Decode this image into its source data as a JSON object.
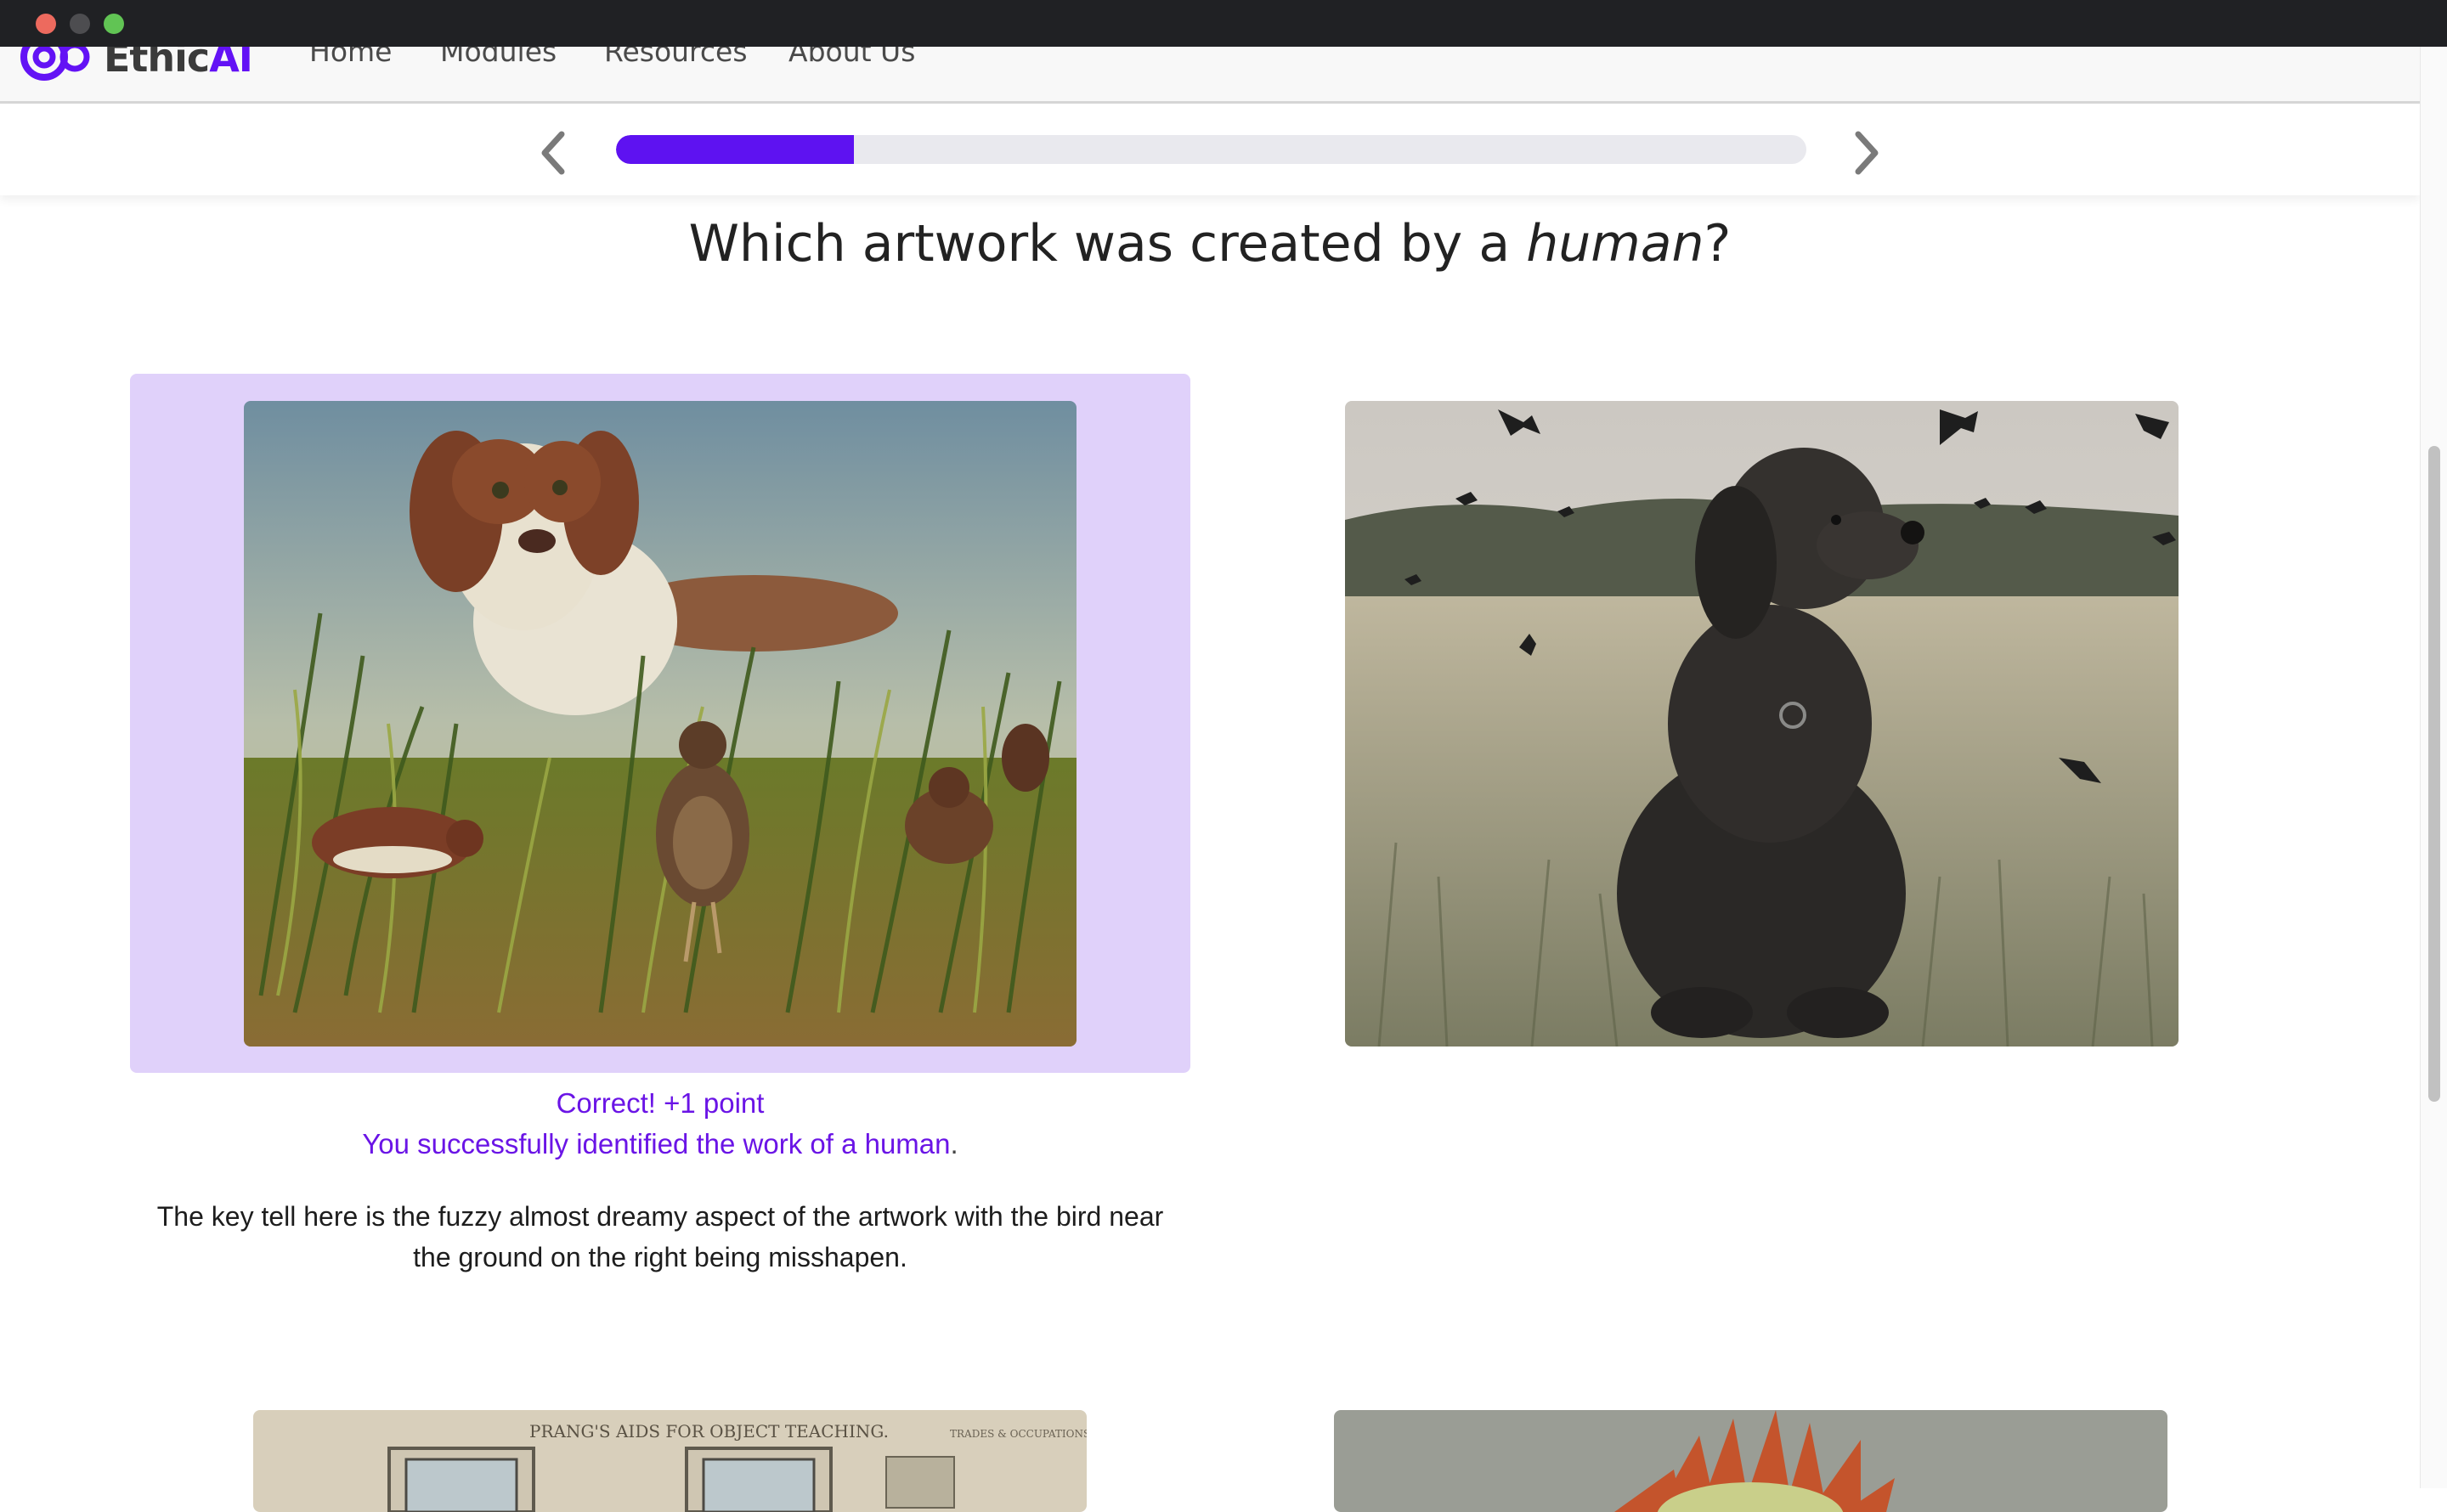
{
  "nav": {
    "logo_ethic": "Ethic",
    "logo_ai": "AI",
    "links": [
      "Home",
      "Modules",
      "Resources",
      "About Us"
    ]
  },
  "progress": {
    "fraction": 0.2
  },
  "question": {
    "prefix": "Which artwork was created by a ",
    "emphasis": "human",
    "suffix": "?"
  },
  "feedback": {
    "line1": "Correct! +1 point",
    "line2": "You successfully identified the work of a human",
    "line2_end": ".",
    "explanation": "The key tell here is the fuzzy almost dreamy aspect of the artwork with the bird near the ground on the right being misshapen."
  },
  "bottom_left_caption": "PRANG'S AIDS FOR OBJECT TEACHING.",
  "bottom_left_sub": "TRADES & OCCUPATIONS",
  "colors": {
    "accent": "#5e12f1",
    "selected_bg": "#e0d1fa",
    "feedback": "#6a14e6"
  },
  "icons": [
    "chevron-left-icon",
    "chevron-right-icon"
  ]
}
